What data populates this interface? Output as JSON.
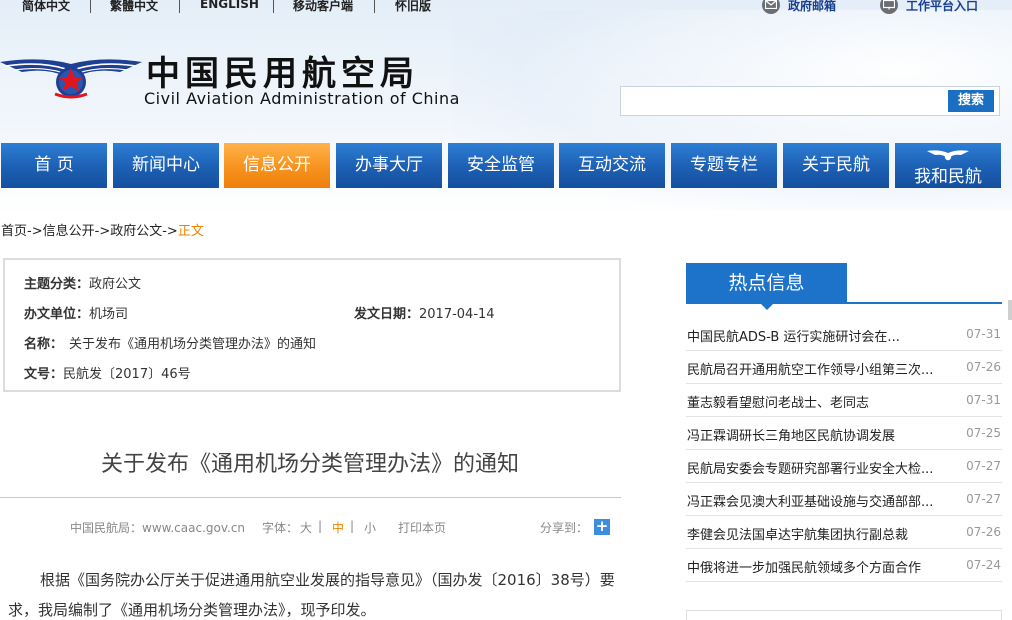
{
  "topbar": {
    "simplified": "简体中文",
    "traditional": "繁體中文",
    "english": "ENGLISH",
    "mobile": "移动客户端",
    "old_version": "怀旧版",
    "gov_mail": "政府邮箱",
    "work_platform": "工作平台入口"
  },
  "logo": {
    "cn": "中国民用航空局",
    "en": "Civil Aviation Administration of China"
  },
  "search": {
    "placeholder": "",
    "button": "搜索"
  },
  "nav": {
    "items": [
      {
        "label": "首 页"
      },
      {
        "label": "新闻中心"
      },
      {
        "label": "信息公开"
      },
      {
        "label": "办事大厅"
      },
      {
        "label": "安全监管"
      },
      {
        "label": "互动交流"
      },
      {
        "label": "专题专栏"
      },
      {
        "label": "关于民航"
      },
      {
        "label": "我和民航"
      }
    ]
  },
  "breadcrumb": {
    "home": "首页",
    "arrow": "->",
    "info": "信息公开",
    "docs": "政府公文",
    "current": "正文"
  },
  "info": {
    "category_label": "主题分类：",
    "category_value": "政府公文",
    "unit_label": "办文单位：",
    "unit_value": "机场司",
    "date_label": "发文日期：",
    "date_value": "2017-04-14",
    "name_label": "名称：",
    "name_value": "关于发布《通用机场分类管理办法》的通知",
    "number_label": "文号：",
    "number_value": "民航发〔2017〕46号"
  },
  "article": {
    "title": "关于发布《通用机场分类管理办法》的通知",
    "source": "中国民航局：www.caac.gov.cn",
    "font_label": "字体：",
    "font_large": "大",
    "font_medium": "中",
    "font_small": "小",
    "divider": "|",
    "print": "打印本页",
    "share": "分享到：",
    "share_icon": "+",
    "body": "根据《国务院办公厅关于促进通用航空业发展的指导意见》（国办发〔2016〕38号）要求，我局编制了《通用机场分类管理办法》，现予印发。"
  },
  "sidebar": {
    "hot_title": "热点信息",
    "news": [
      {
        "title": "中国民航ADS-B 运行实施研讨会在...",
        "date": "07-31"
      },
      {
        "title": "民航局召开通用航空工作领导小组第三次...",
        "date": "07-26"
      },
      {
        "title": "董志毅看望慰问老战士、老同志",
        "date": "07-31"
      },
      {
        "title": "冯正霖调研长三角地区民航协调发展",
        "date": "07-25"
      },
      {
        "title": "民航局安委会专题研究部署行业安全大检...",
        "date": "07-27"
      },
      {
        "title": "冯正霖会见澳大利亚基础设施与交通部部...",
        "date": "07-27"
      },
      {
        "title": "李健会见法国卓达宇航集团执行副总裁",
        "date": "07-26"
      },
      {
        "title": "中俄将进一步加强民航领域多个方面合作",
        "date": "07-24"
      }
    ]
  },
  "colors": {
    "nav_blue": "#1c5fb3",
    "nav_active": "#f7931e",
    "accent_orange": "#f08300",
    "hot_blue": "#1d72c9"
  }
}
